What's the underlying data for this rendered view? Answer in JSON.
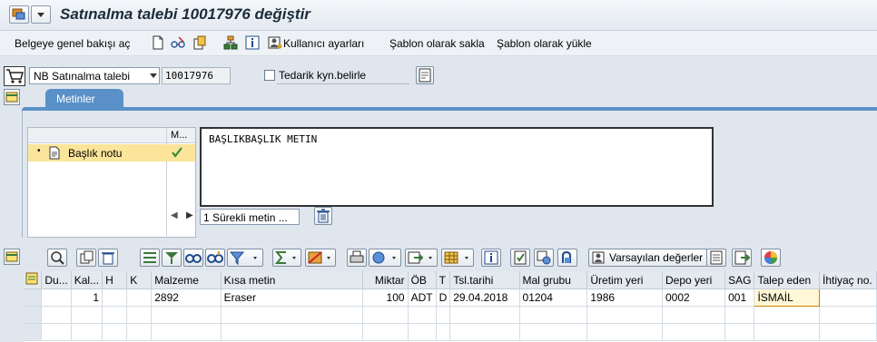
{
  "title": "Satınalma talebi 10017976 değiştir",
  "app_toolbar": {
    "overview_label": "Belgeye genel bakışı aç",
    "user_settings_label": "Kullanıcı ayarları",
    "save_template_label": "Şablon olarak sakla",
    "load_template_label": "Şablon olarak yükle"
  },
  "header": {
    "doc_type": "NB Satınalma talebi",
    "doc_number": "10017976",
    "vendor_checkbox_label": "Tedarik kyn.belirle"
  },
  "tabs": [
    {
      "label": "Metinler"
    }
  ],
  "texts": {
    "col_m_header": "M...",
    "tree_item": "Başlık notu",
    "editor_text": "BAŞLIKBAŞLIK METIN",
    "format_select": "1 Sürekli metin ..."
  },
  "grid_toolbar": {
    "defaults_button": "Varsayılan değerler"
  },
  "grid": {
    "columns": [
      "Du...",
      "Kal...",
      "H",
      "K",
      "Malzeme",
      "Kısa metin",
      "Miktar",
      "ÖB",
      "T",
      "Tsl.tarihi",
      "Mal grubu",
      "Üretim yeri",
      "Depo yeri",
      "SAG",
      "Talep eden",
      "İhtiyaç no."
    ],
    "rows": [
      {
        "status": "",
        "item": "1",
        "h": "",
        "k": "",
        "material": "2892",
        "short_text": "Eraser",
        "quantity": "100",
        "unit": "ADT",
        "t": "D",
        "delivery_date": "29.04.2018",
        "material_group": "01204",
        "plant": "1986",
        "storage_loc": "0002",
        "purch_group": "001",
        "requisitioner": "İSMAİL",
        "tracking_no": ""
      }
    ]
  }
}
